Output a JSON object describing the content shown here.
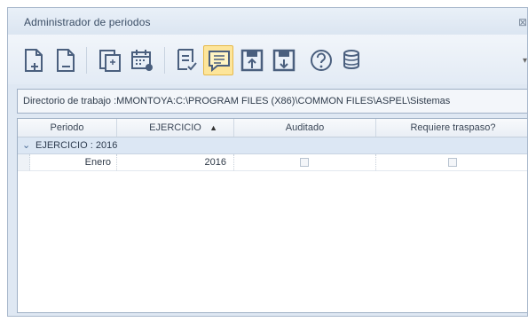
{
  "window": {
    "title": "Administrador de periodos",
    "close_glyph": "⊠"
  },
  "toolbar": {
    "icons": [
      "new-document-plus-icon",
      "new-document-minus-icon",
      "copy-period-icon",
      "calendar-settings-icon",
      "document-check-icon",
      "comment-note-icon",
      "save-up-icon",
      "save-down-icon",
      "help-icon",
      "database-icon"
    ],
    "selected_icon": "comment-note-icon",
    "more_glyph": "▾"
  },
  "directory": {
    "label": "Directorio de trabajo :",
    "path": "MMONTOYA:C:\\PROGRAM FILES (X86)\\COMMON FILES\\ASPEL\\Sistemas"
  },
  "grid": {
    "columns": [
      "Periodo",
      "EJERCICIO",
      "Auditado",
      "Requiere traspaso?"
    ],
    "sort_glyph": "▲",
    "group": {
      "chevron": "⌄",
      "label": "EJERCICIO : 2016"
    },
    "rows": [
      {
        "periodo": "Enero",
        "ejercicio": "2016",
        "auditado": false,
        "traspaso": false
      }
    ]
  },
  "colors": {
    "accent": "#fde59a",
    "icon_stroke": "#4a5f7e"
  }
}
